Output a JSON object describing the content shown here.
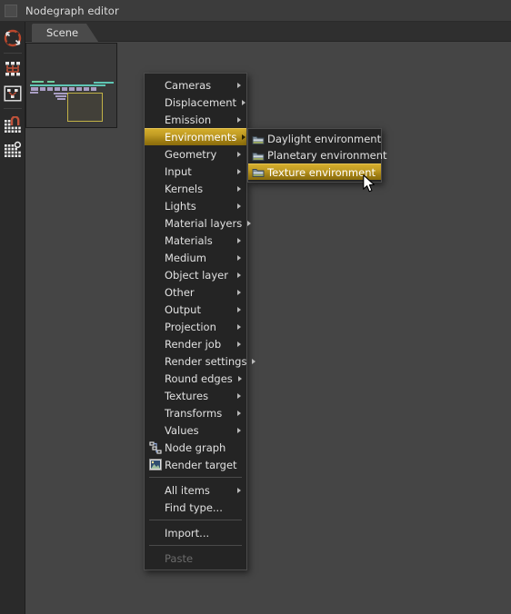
{
  "window": {
    "title": "Nodegraph editor"
  },
  "tabs": [
    {
      "label": "Scene",
      "active": true
    }
  ],
  "rail": {
    "icons": [
      {
        "name": "node-target-icon"
      },
      {
        "name": "node-group-icon"
      },
      {
        "name": "node-select-icon"
      },
      {
        "name": "grid-magnet-icon"
      },
      {
        "name": "grid-snap-icon"
      }
    ]
  },
  "navigator": {
    "label": "node-graph-navigator"
  },
  "context_menu": {
    "groups": [
      {
        "items": [
          {
            "label": "Cameras",
            "submenu": true,
            "icon": null,
            "selected": false,
            "disabled": false
          },
          {
            "label": "Displacement",
            "submenu": true,
            "icon": null,
            "selected": false,
            "disabled": false
          },
          {
            "label": "Emission",
            "submenu": true,
            "icon": null,
            "selected": false,
            "disabled": false
          },
          {
            "label": "Environments",
            "submenu": true,
            "icon": null,
            "selected": true,
            "disabled": false
          },
          {
            "label": "Geometry",
            "submenu": true,
            "icon": null,
            "selected": false,
            "disabled": false
          },
          {
            "label": "Input",
            "submenu": true,
            "icon": null,
            "selected": false,
            "disabled": false
          },
          {
            "label": "Kernels",
            "submenu": true,
            "icon": null,
            "selected": false,
            "disabled": false
          },
          {
            "label": "Lights",
            "submenu": true,
            "icon": null,
            "selected": false,
            "disabled": false
          },
          {
            "label": "Material layers",
            "submenu": true,
            "icon": null,
            "selected": false,
            "disabled": false
          },
          {
            "label": "Materials",
            "submenu": true,
            "icon": null,
            "selected": false,
            "disabled": false
          },
          {
            "label": "Medium",
            "submenu": true,
            "icon": null,
            "selected": false,
            "disabled": false
          },
          {
            "label": "Object layer",
            "submenu": true,
            "icon": null,
            "selected": false,
            "disabled": false
          },
          {
            "label": "Other",
            "submenu": true,
            "icon": null,
            "selected": false,
            "disabled": false
          },
          {
            "label": "Output",
            "submenu": true,
            "icon": null,
            "selected": false,
            "disabled": false
          },
          {
            "label": "Projection",
            "submenu": true,
            "icon": null,
            "selected": false,
            "disabled": false
          },
          {
            "label": "Render job",
            "submenu": true,
            "icon": null,
            "selected": false,
            "disabled": false
          },
          {
            "label": "Render settings",
            "submenu": true,
            "icon": null,
            "selected": false,
            "disabled": false
          },
          {
            "label": "Round edges",
            "submenu": true,
            "icon": null,
            "selected": false,
            "disabled": false
          },
          {
            "label": "Textures",
            "submenu": true,
            "icon": null,
            "selected": false,
            "disabled": false
          },
          {
            "label": "Transforms",
            "submenu": true,
            "icon": null,
            "selected": false,
            "disabled": false
          },
          {
            "label": "Values",
            "submenu": true,
            "icon": null,
            "selected": false,
            "disabled": false
          },
          {
            "label": "Node graph",
            "submenu": false,
            "icon": "node-graph-icon",
            "selected": false,
            "disabled": false
          },
          {
            "label": "Render target",
            "submenu": false,
            "icon": "render-target-icon",
            "selected": false,
            "disabled": false
          }
        ]
      },
      {
        "items": [
          {
            "label": "All items",
            "submenu": true,
            "icon": null,
            "selected": false,
            "disabled": false
          },
          {
            "label": "Find type...",
            "submenu": false,
            "icon": null,
            "selected": false,
            "disabled": false
          }
        ]
      },
      {
        "items": [
          {
            "label": "Import...",
            "submenu": false,
            "icon": null,
            "selected": false,
            "disabled": false
          }
        ]
      },
      {
        "items": [
          {
            "label": "Paste",
            "submenu": false,
            "icon": null,
            "selected": false,
            "disabled": true
          }
        ]
      }
    ]
  },
  "submenu": {
    "parent": "Environments",
    "items": [
      {
        "label": "Daylight environment",
        "icon": "environment-icon",
        "selected": false
      },
      {
        "label": "Planetary environment",
        "icon": "environment-icon",
        "selected": false
      },
      {
        "label": "Texture environment",
        "icon": "environment-icon",
        "selected": true
      }
    ]
  },
  "colors": {
    "window_bg": "#454545",
    "titlebar_bg": "#3c3c3c",
    "rail_bg": "#2a2a2a",
    "menu_bg": "#242424",
    "menu_border": "#4c4c4c",
    "highlight_gold": "#c29d24",
    "text": "#e0e0e0",
    "text_disabled": "#6b6b6b",
    "navigator_node": "#a99ec4",
    "navigator_viewbox": "#c2b247"
  }
}
